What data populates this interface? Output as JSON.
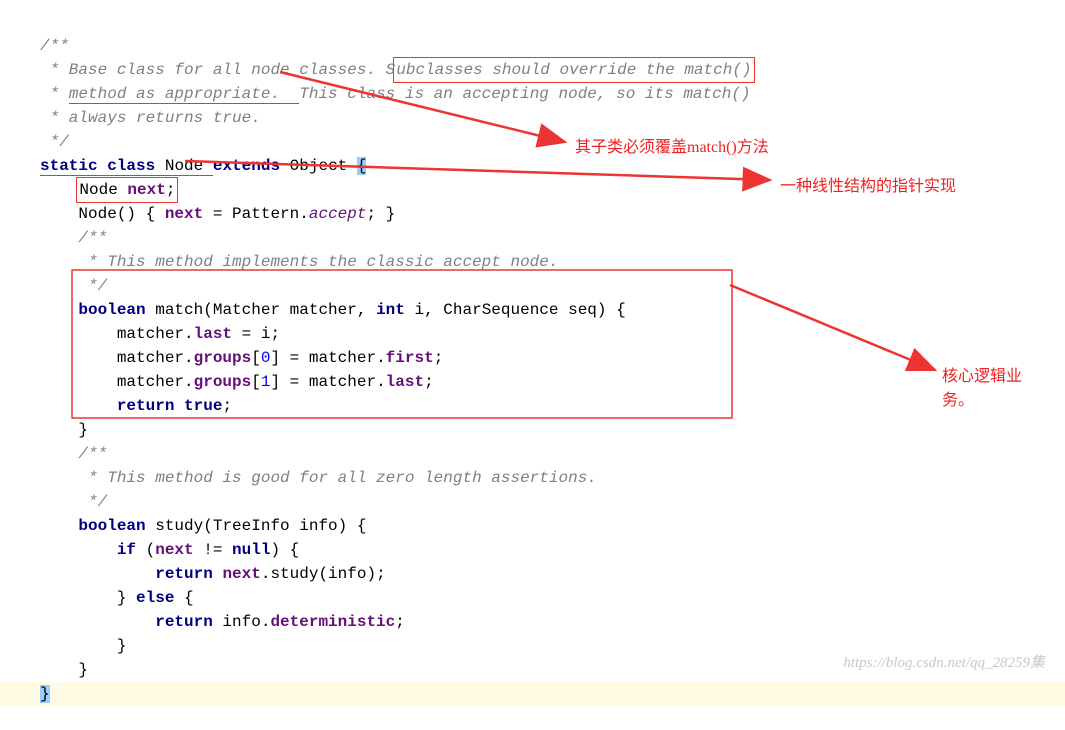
{
  "code": {
    "c1": "/**",
    "c2l": " * Base class for all node classes. S",
    "c2r": "ubclasses should override the match()",
    "c3l": " * ",
    "c3m": "method as appropriate.  ",
    "c3r": "This class is an accepting node, so its match()",
    "c4": " * always returns true.",
    "c5": " */",
    "l1a": "static",
    "l1b": " ",
    "l1c": "class",
    "l1d": " Node ",
    "l1e": "extends",
    "l1f": " Object ",
    "l1g": "{",
    "l2a": "    ",
    "l2b": "Node ",
    "l2c": "next",
    "l2d": ";",
    "l3a": "    Node() ",
    "l3b": "{ ",
    "l3c": "next",
    "l3d": " = Pattern.",
    "l3e": "accept",
    "l3f": "; ",
    "l3g": "}",
    "c6": "    /**",
    "c7": "     * This method implements the classic accept node.",
    "c8": "     */",
    "l4a": "    ",
    "l4b": "boolean",
    "l4c": " match(Matcher matcher, ",
    "l4d": "int",
    "l4e": " i, CharSequence seq) {",
    "l5a": "        matcher.",
    "l5b": "last",
    "l5c": " = i;",
    "l6a": "        matcher.",
    "l6b": "groups",
    "l6c": "[",
    "l6d": "0",
    "l6e": "] = matcher.",
    "l6f": "first",
    "l6g": ";",
    "l7a": "        matcher.",
    "l7b": "groups",
    "l7c": "[",
    "l7d": "1",
    "l7e": "] = matcher.",
    "l7f": "last",
    "l7g": ";",
    "l8a": "        ",
    "l8b": "return true",
    "l8c": ";",
    "l9": "    }",
    "c9": "    /**",
    "c10": "     * This method is good for all zero length assertions.",
    "c11": "     */",
    "l10a": "    ",
    "l10b": "boolean",
    "l10c": " study(TreeInfo info) {",
    "l11a": "        ",
    "l11b": "if",
    "l11c": " (",
    "l11d": "next",
    "l11e": " != ",
    "l11f": "null",
    "l11g": ") {",
    "l12a": "            ",
    "l12b": "return",
    "l12c": " ",
    "l12d": "next",
    "l12e": ".study(info);",
    "l13": "        } ",
    "l13b": "else",
    "l13c": " {",
    "l14a": "            ",
    "l14b": "return",
    "l14c": " info.",
    "l14d": "deterministic",
    "l14e": ";",
    "l15": "        }",
    "l16": "    }",
    "l17": "}"
  },
  "annotations": {
    "a1": "其子类必须覆盖match()方法",
    "a2": "一种线性结构的指针实现",
    "a3a": "核心逻辑业",
    "a3b": "务。"
  },
  "watermark": "https://blog.csdn.net/qq_28259集"
}
